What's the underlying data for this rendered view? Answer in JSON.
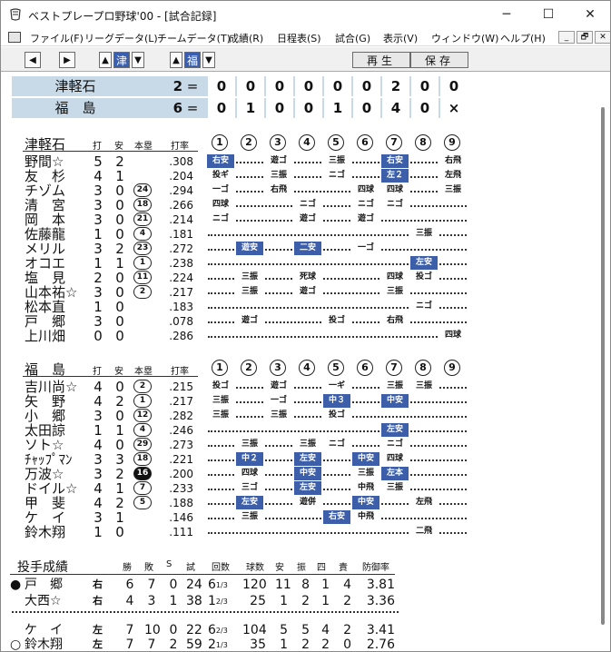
{
  "window": {
    "title": "ベストプレープロ野球'00 - [試合記録]",
    "controls": [
      "─",
      "☐",
      "✕"
    ]
  },
  "menu": [
    "ファイル(F)",
    "リーグデータ(L)",
    "チームデータ(T)",
    "成績(R)",
    "日程表(S)",
    "試合(G)",
    "表示(V)",
    "ウィンドウ(W)",
    "ヘルプ(H)"
  ],
  "mdi": [
    "_",
    "🗗",
    "✕"
  ],
  "toolbar": {
    "team_away": "津",
    "team_home": "福",
    "play": "再生",
    "save": "保存"
  },
  "scoreboard": {
    "rows": [
      {
        "team": "津軽石",
        "total": "2",
        "innings": [
          "0",
          "0",
          "0",
          "0",
          "0",
          "0",
          "2",
          "0",
          "0"
        ]
      },
      {
        "team": "福　島",
        "total": "6",
        "innings": [
          "0",
          "1",
          "0",
          "0",
          "1",
          "0",
          "4",
          "0",
          "×"
        ]
      }
    ],
    "eq": "="
  },
  "headers": {
    "ab": "打",
    "h": "安",
    "hr": "本塁",
    "avg": "打率",
    "innings": [
      "1",
      "2",
      "3",
      "4",
      "5",
      "6",
      "7",
      "8",
      "9"
    ]
  },
  "away": {
    "team": "津軽石",
    "players": [
      {
        "name": "野間☆",
        "ab": "5",
        "h": "2",
        "hr": "",
        "hrfill": false,
        "avg": ".308",
        "r": [
          [
            "右安",
            1
          ],
          "",
          "遊ゴ",
          "",
          "三振",
          "",
          "右安",
          1,
          "",
          "右飛"
        ]
      },
      {
        "name": "友　杉",
        "ab": "4",
        "h": "1",
        "hr": "",
        "hrfill": false,
        "avg": ".204",
        "r": []
      },
      {
        "name": "チゾム",
        "ab": "3",
        "h": "0",
        "hr": "24",
        "hrfill": false,
        "avg": ".294",
        "r": []
      },
      {
        "name": "清　宮",
        "ab": "3",
        "h": "0",
        "hr": "18",
        "hrfill": false,
        "avg": ".266",
        "r": []
      },
      {
        "name": "岡　本",
        "ab": "3",
        "h": "0",
        "hr": "21",
        "hrfill": false,
        "avg": ".214",
        "r": []
      },
      {
        "name": "佐藤龍",
        "ab": "1",
        "h": "0",
        "hr": "4",
        "hrfill": false,
        "avg": ".181",
        "r": []
      },
      {
        "name": "メリル",
        "ab": "3",
        "h": "2",
        "hr": "23",
        "hrfill": false,
        "avg": ".272",
        "r": []
      },
      {
        "name": "オコエ",
        "ab": "1",
        "h": "1",
        "hr": "1",
        "hrfill": false,
        "avg": ".238",
        "r": []
      },
      {
        "name": "塩　見",
        "ab": "2",
        "h": "0",
        "hr": "11",
        "hrfill": false,
        "avg": ".224",
        "r": []
      },
      {
        "name": "山本祐☆",
        "ab": "3",
        "h": "0",
        "hr": "2",
        "hrfill": false,
        "avg": ".217",
        "r": []
      },
      {
        "name": "松本直",
        "ab": "1",
        "h": "0",
        "hr": "",
        "hrfill": false,
        "avg": ".183",
        "r": []
      },
      {
        "name": "戸　郷",
        "ab": "3",
        "h": "0",
        "hr": "",
        "hrfill": false,
        "avg": ".078",
        "r": []
      },
      {
        "name": "上川畑",
        "ab": "0",
        "h": "0",
        "hr": "",
        "hrfill": false,
        "avg": ".286",
        "r": []
      }
    ],
    "results": [
      [
        [
          "右安",
          true
        ],
        null,
        [
          "遊ゴ",
          false
        ],
        null,
        [
          "三振",
          false
        ],
        null,
        [
          "右安",
          true
        ],
        null,
        [
          "右飛",
          false
        ]
      ],
      [
        [
          "投ギ",
          false
        ],
        null,
        [
          "三振",
          false
        ],
        null,
        [
          "ニゴ",
          false
        ],
        null,
        [
          "左２",
          true
        ],
        null,
        [
          "左飛",
          false
        ]
      ],
      [
        [
          "一ゴ",
          false
        ],
        null,
        [
          "右飛",
          false
        ],
        null,
        null,
        [
          "四球",
          false
        ],
        [
          "四球",
          false
        ],
        null,
        [
          "三振",
          false
        ]
      ],
      [
        [
          "四球",
          false
        ],
        null,
        null,
        [
          "ニゴ",
          false
        ],
        null,
        [
          "ニゴ",
          false
        ],
        [
          "ニゴ",
          false
        ],
        null,
        null
      ],
      [
        [
          "ニゴ",
          false
        ],
        null,
        null,
        [
          "遊ゴ",
          false
        ],
        null,
        [
          "遊ゴ",
          false
        ],
        null,
        null,
        null
      ],
      [
        null,
        null,
        null,
        null,
        null,
        null,
        null,
        [
          "三振",
          false
        ],
        null
      ],
      [
        null,
        [
          "遊安",
          true
        ],
        null,
        [
          "二安",
          true
        ],
        null,
        [
          "一ゴ",
          false
        ],
        null,
        null,
        null
      ],
      [
        null,
        null,
        null,
        null,
        null,
        null,
        null,
        [
          "左安",
          true
        ],
        null
      ],
      [
        null,
        [
          "三振",
          false
        ],
        null,
        [
          "死球",
          false
        ],
        null,
        null,
        [
          "四球",
          false
        ],
        [
          "投ゴ",
          false
        ],
        null
      ],
      [
        null,
        [
          "三振",
          false
        ],
        null,
        [
          "遊ゴ",
          false
        ],
        null,
        null,
        [
          "三振",
          false
        ],
        null,
        null
      ],
      [
        null,
        null,
        null,
        null,
        null,
        null,
        null,
        [
          "ニゴ",
          false
        ],
        null
      ],
      [
        null,
        [
          "遊ゴ",
          false
        ],
        null,
        null,
        [
          "投ゴ",
          false
        ],
        null,
        [
          "右飛",
          false
        ],
        null,
        null
      ],
      [
        null,
        null,
        null,
        null,
        null,
        null,
        null,
        null,
        [
          "四球",
          false
        ]
      ]
    ]
  },
  "home": {
    "team": "福　島",
    "players": [
      {
        "name": "吉川尚☆",
        "ab": "4",
        "h": "0",
        "hr": "2",
        "hrfill": false,
        "avg": ".215"
      },
      {
        "name": "矢　野",
        "ab": "4",
        "h": "2",
        "hr": "1",
        "hrfill": false,
        "avg": ".217"
      },
      {
        "name": "小　郷",
        "ab": "3",
        "h": "0",
        "hr": "12",
        "hrfill": false,
        "avg": ".282"
      },
      {
        "name": "太田諒",
        "ab": "1",
        "h": "1",
        "hr": "4",
        "hrfill": false,
        "avg": ".246"
      },
      {
        "name": "ソト☆",
        "ab": "4",
        "h": "0",
        "hr": "29",
        "hrfill": false,
        "avg": ".273"
      },
      {
        "name": "ﾁｬｯﾌﾟﾏﾝ",
        "ab": "3",
        "h": "3",
        "hr": "18",
        "hrfill": false,
        "avg": ".221"
      },
      {
        "name": "万波☆",
        "ab": "3",
        "h": "2",
        "hr": "16",
        "hrfill": true,
        "avg": ".200"
      },
      {
        "name": "ドイル☆",
        "ab": "4",
        "h": "1",
        "hr": "7",
        "hrfill": false,
        "avg": ".233"
      },
      {
        "name": "甲　斐",
        "ab": "4",
        "h": "2",
        "hr": "5",
        "hrfill": false,
        "avg": ".188"
      },
      {
        "name": "ケ　イ",
        "ab": "3",
        "h": "1",
        "hr": "",
        "hrfill": false,
        "avg": ".146"
      },
      {
        "name": "鈴木翔",
        "ab": "1",
        "h": "0",
        "hr": "",
        "hrfill": false,
        "avg": ".111"
      }
    ],
    "results": [
      [
        [
          "投ゴ",
          false
        ],
        null,
        [
          "遊ゴ",
          false
        ],
        null,
        [
          "一ギ",
          false
        ],
        null,
        [
          "三振",
          false
        ],
        [
          "三振",
          false
        ],
        null
      ],
      [
        [
          "三振",
          false
        ],
        null,
        [
          "一ゴ",
          false
        ],
        null,
        [
          "中３",
          true
        ],
        null,
        [
          "中安",
          true
        ],
        null,
        null
      ],
      [
        [
          "三振",
          false
        ],
        null,
        [
          "三振",
          false
        ],
        null,
        [
          "投ゴ",
          false
        ],
        null,
        null,
        null,
        null
      ],
      [
        null,
        null,
        null,
        null,
        null,
        null,
        [
          "左安",
          true
        ],
        null,
        null
      ],
      [
        null,
        [
          "三振",
          false
        ],
        null,
        [
          "三振",
          false
        ],
        [
          "ニゴ",
          false
        ],
        null,
        [
          "ニゴ",
          false
        ],
        null,
        null
      ],
      [
        null,
        [
          "中２",
          true
        ],
        null,
        [
          "左安",
          true
        ],
        null,
        [
          "中安",
          true
        ],
        [
          "四球",
          false
        ],
        null,
        null
      ],
      [
        null,
        [
          "四球",
          false
        ],
        null,
        [
          "中安",
          true
        ],
        null,
        [
          "三振",
          false
        ],
        [
          "左本",
          true
        ],
        null,
        null
      ],
      [
        null,
        [
          "三ゴ",
          false
        ],
        null,
        [
          "左安",
          true
        ],
        null,
        [
          "中飛",
          false
        ],
        [
          "三振",
          false
        ],
        null,
        null
      ],
      [
        null,
        [
          "左安",
          true
        ],
        null,
        [
          "遊併",
          false
        ],
        null,
        [
          "中安",
          true
        ],
        null,
        [
          "左飛",
          false
        ],
        null
      ],
      [
        null,
        [
          "三振",
          false
        ],
        null,
        null,
        [
          "右安",
          true
        ],
        [
          "中飛",
          false
        ],
        null,
        null,
        null
      ],
      [
        null,
        null,
        null,
        null,
        null,
        null,
        null,
        [
          "二飛",
          false
        ],
        null
      ]
    ]
  },
  "pitching": {
    "title": "投手成績",
    "cols": [
      "勝",
      "敗",
      "S",
      "試",
      "回数",
      "球数",
      "安",
      "振",
      "四",
      "責",
      "防御率"
    ],
    "rows": [
      {
        "mark": "●",
        "name": "戸　郷",
        "hand": "右",
        "w": "6",
        "l": "7",
        "s": "0",
        "g": "24",
        "ip_int": "6",
        "ip_frac": "1/3",
        "np": "120",
        "h": "11",
        "k": "8",
        "bb": "1",
        "er": "4",
        "era": "3.81"
      },
      {
        "mark": "",
        "name": "大西☆",
        "hand": "右",
        "w": "4",
        "l": "3",
        "s": "1",
        "g": "38",
        "ip_int": "1",
        "ip_frac": "2/3",
        "np": "25",
        "h": "1",
        "k": "2",
        "bb": "1",
        "er": "2",
        "era": "3.36"
      },
      {
        "mark": "",
        "name": "ケ　イ",
        "hand": "左",
        "w": "7",
        "l": "10",
        "s": "0",
        "g": "22",
        "ip_int": "6",
        "ip_frac": "2/3",
        "np": "104",
        "h": "5",
        "k": "5",
        "bb": "4",
        "er": "2",
        "era": "3.41"
      },
      {
        "mark": "○",
        "name": "鈴木翔",
        "hand": "左",
        "w": "7",
        "l": "7",
        "s": "2",
        "g": "59",
        "ip_int": "2",
        "ip_frac": "1/3",
        "np": "35",
        "h": "1",
        "k": "2",
        "bb": "2",
        "er": "0",
        "era": "2.76"
      }
    ]
  }
}
